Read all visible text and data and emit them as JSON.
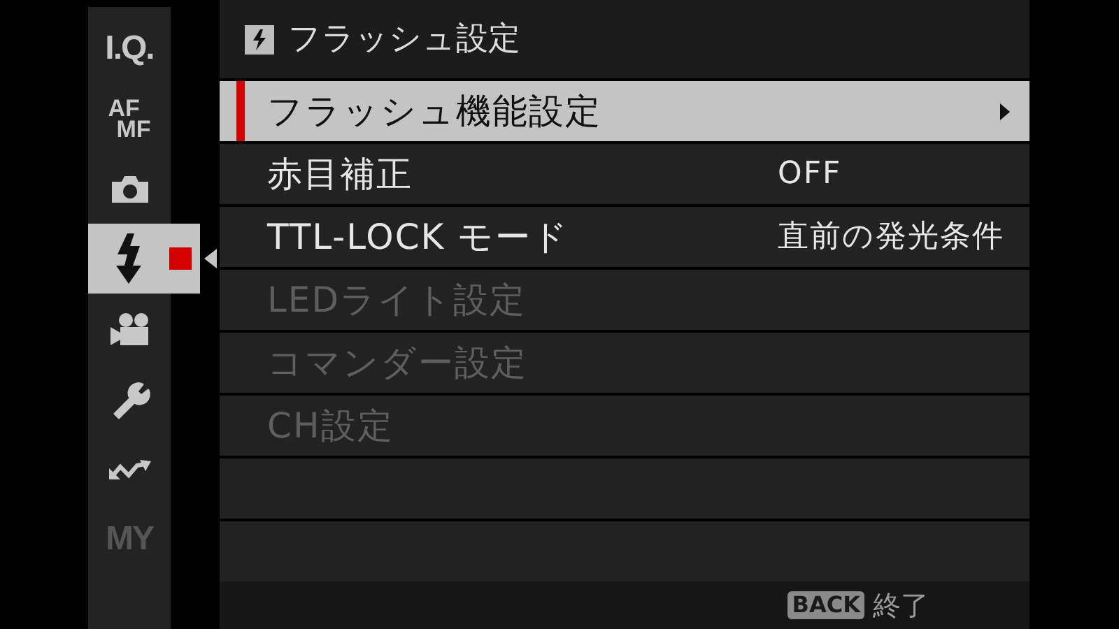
{
  "sidebar": {
    "items": [
      {
        "kind": "text",
        "label": "I.Q.",
        "selected": false,
        "disabled": false
      },
      {
        "kind": "afmf",
        "label": "AF",
        "label2": "MF",
        "selected": false,
        "disabled": false
      },
      {
        "kind": "camera",
        "selected": false,
        "disabled": false
      },
      {
        "kind": "flash",
        "selected": true,
        "disabled": false
      },
      {
        "kind": "movie",
        "selected": false,
        "disabled": false
      },
      {
        "kind": "wrench",
        "selected": false,
        "disabled": false
      },
      {
        "kind": "arrows",
        "selected": false,
        "disabled": false
      },
      {
        "kind": "text",
        "label": "MY",
        "selected": false,
        "disabled": true
      }
    ]
  },
  "header": {
    "title": "フラッシュ設定"
  },
  "rows": [
    {
      "label": "フラッシュ機能設定",
      "selected": true,
      "disabled": false,
      "submenu": true
    },
    {
      "label": "赤目補正",
      "value": "OFF",
      "selected": false,
      "disabled": false,
      "submenu": false
    },
    {
      "label": "TTL-LOCK モード",
      "value": "直前の発光条件",
      "selected": false,
      "disabled": false,
      "submenu": false
    },
    {
      "label": "LEDライト設定",
      "selected": false,
      "disabled": true,
      "submenu": false
    },
    {
      "label": "コマンダー設定",
      "selected": false,
      "disabled": true,
      "submenu": false
    },
    {
      "label": "CH設定",
      "selected": false,
      "disabled": true,
      "submenu": false
    }
  ],
  "footer": {
    "key": "BACK",
    "action": "終了"
  }
}
